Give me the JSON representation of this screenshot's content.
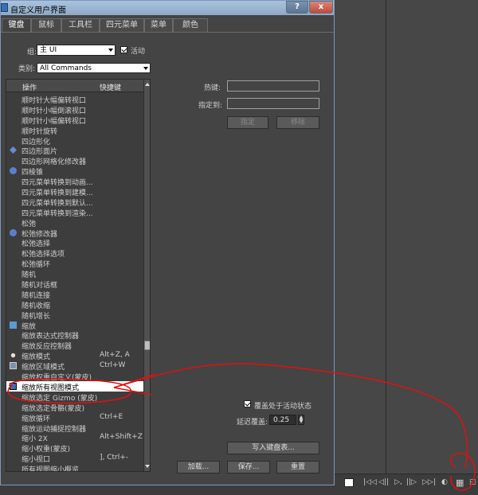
{
  "window": {
    "title": "自定义用户界面",
    "help_label": "?",
    "close_label": "x"
  },
  "tabs": [
    "键盘",
    "鼠标",
    "工具栏",
    "四元菜单",
    "菜单",
    "颜色"
  ],
  "group": {
    "label": "组:",
    "value": "主 UI",
    "active_label": "活动",
    "active_checked": true
  },
  "category": {
    "label": "类别:",
    "value": "All Commands"
  },
  "list": {
    "header_action": "操作",
    "header_shortcut": "快捷键",
    "rows": [
      {
        "name": "顺时针大幅偏转视口",
        "key": "",
        "icon": ""
      },
      {
        "name": "顺时针小幅倒滚视口",
        "key": "",
        "icon": ""
      },
      {
        "name": "顺时针小幅偏转视口",
        "key": "",
        "icon": ""
      },
      {
        "name": "顺时针旋转",
        "key": "",
        "icon": ""
      },
      {
        "name": "四边形化",
        "key": "",
        "icon": ""
      },
      {
        "name": "四边形面片",
        "key": "",
        "icon": "diamond-icon"
      },
      {
        "name": "四边形网格化修改器",
        "key": "",
        "icon": ""
      },
      {
        "name": "四棱锥",
        "key": "",
        "icon": "pyramid-icon"
      },
      {
        "name": "四元菜单转换到动画...",
        "key": "",
        "icon": ""
      },
      {
        "name": "四元菜单转换到建模...",
        "key": "",
        "icon": ""
      },
      {
        "name": "四元菜单转换到默认...",
        "key": "",
        "icon": ""
      },
      {
        "name": "四元菜单转换到渲染...",
        "key": "",
        "icon": ""
      },
      {
        "name": "松弛",
        "key": "",
        "icon": ""
      },
      {
        "name": "松弛修改器",
        "key": "",
        "icon": "modifier-icon"
      },
      {
        "name": "松弛选择",
        "key": "",
        "icon": ""
      },
      {
        "name": "松弛选择选项",
        "key": "",
        "icon": ""
      },
      {
        "name": "松弛循环",
        "key": "",
        "icon": ""
      },
      {
        "name": "随机",
        "key": "",
        "icon": ""
      },
      {
        "name": "随机对话框",
        "key": "",
        "icon": ""
      },
      {
        "name": "随机连接",
        "key": "",
        "icon": ""
      },
      {
        "name": "随机收缩",
        "key": "",
        "icon": ""
      },
      {
        "name": "随机增长",
        "key": "",
        "icon": ""
      },
      {
        "name": "缩放",
        "key": "",
        "icon": "scale-icon"
      },
      {
        "name": "缩放表达式控制器",
        "key": "",
        "icon": ""
      },
      {
        "name": "缩放反应控制器",
        "key": "",
        "icon": ""
      },
      {
        "name": "缩放模式",
        "key": "Alt+Z, A",
        "icon": "dot-icon"
      },
      {
        "name": "缩放区域模式",
        "key": "Ctrl+W",
        "icon": "region-icon"
      },
      {
        "name": "缩放权重自定义(蒙皮)",
        "key": "",
        "icon": ""
      },
      {
        "name": "缩放所有视图模式",
        "key": "",
        "icon": "zoom-all-icon",
        "selected": true
      },
      {
        "name": "缩放选定 Gizmo (蒙皮)",
        "key": "",
        "icon": ""
      },
      {
        "name": "缩放选定骨骼(蒙皮)",
        "key": "",
        "icon": ""
      },
      {
        "name": "缩放循环",
        "key": "Ctrl+E",
        "icon": ""
      },
      {
        "name": "缩放运动捕捉控制器",
        "key": "",
        "icon": ""
      },
      {
        "name": "缩小 2X",
        "key": "Alt+Shift+Z",
        "icon": ""
      },
      {
        "name": "缩小权重(蒙皮)",
        "key": "",
        "icon": ""
      },
      {
        "name": "缩小视口",
        "key": "], Ctrl+-",
        "icon": ""
      },
      {
        "name": "所有视图缩小概览",
        "key": "",
        "icon": ""
      }
    ]
  },
  "hotkey": {
    "label": "热键:",
    "value": ""
  },
  "assigned_to": {
    "label": "指定到:",
    "value": ""
  },
  "buttons": {
    "assign": "指定",
    "remove": "移除",
    "write_keyboard_chart": "写入键盘表...",
    "load": "加载...",
    "save": "保存...",
    "reset": "重置"
  },
  "override": {
    "label": "覆盖处于活动状态",
    "checked": true
  },
  "delay": {
    "label": "延迟覆盖:",
    "value": "0.25"
  },
  "colors": {
    "selected_row_bg": "#ffffff",
    "annotation": "#e01010",
    "title_bar": "#9fb9d5"
  }
}
